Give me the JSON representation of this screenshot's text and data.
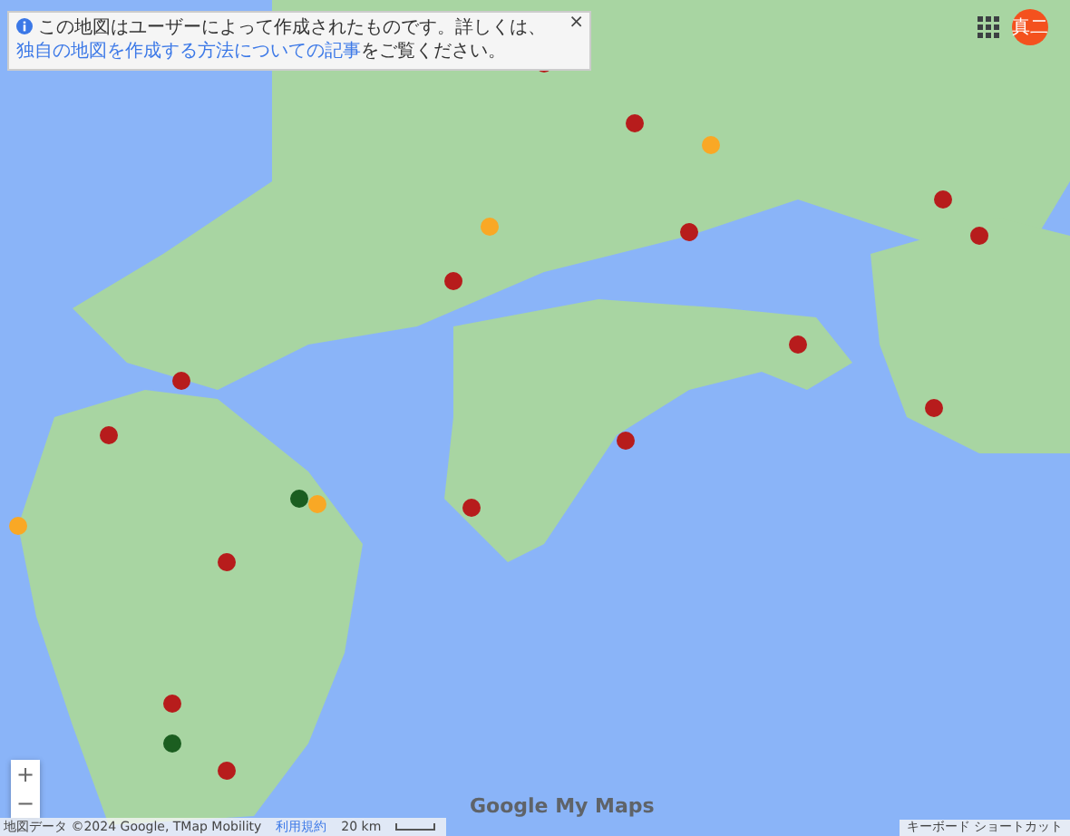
{
  "notice": {
    "text": "この地図はユーザーによって作成されたものです。詳しくは、",
    "link": "独自の地図を作成する方法についての記事",
    "suffix": "をご覧ください。",
    "close": "×"
  },
  "account": {
    "avatar_text": "真二"
  },
  "zoom_controls": [
    "+",
    "−"
  ],
  "logo": "Google My Maps",
  "footer": {
    "attribution": "地図データ ©2024 Google, TMap Mobility",
    "terms": "利用規約",
    "scale": "20 km",
    "shortcuts": "キーボード ショートカット"
  }
}
